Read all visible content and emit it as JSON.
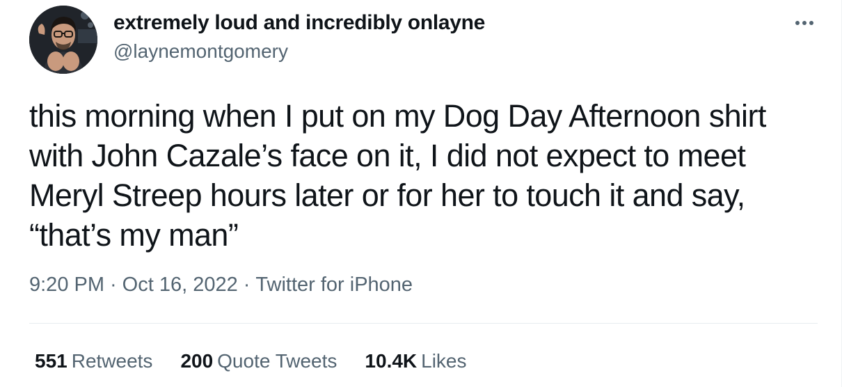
{
  "author": {
    "display_name": "extremely loud and incredibly onlayne",
    "handle": "@laynemontgomery",
    "avatar_icon": "profile-photo"
  },
  "more_icon": "ellipsis-icon",
  "tweet": {
    "lines": [
      "this morning when I put on my Dog Day Afternoon shirt",
      "with John Cazale’s face on it, I did not expect to meet",
      "Meryl Streep hours later or for her to touch it and say,",
      "“that’s my man”"
    ]
  },
  "meta": {
    "time": "9:20 PM",
    "separator": "·",
    "date": "Oct 16, 2022",
    "source": "Twitter for iPhone"
  },
  "stats": {
    "retweets": {
      "count": "551",
      "label": "Retweets"
    },
    "quotes": {
      "count": "200",
      "label": "Quote Tweets"
    },
    "likes": {
      "count": "10.4K",
      "label": "Likes"
    }
  },
  "colors": {
    "text_primary": "#0f1419",
    "text_secondary": "#536471",
    "divider": "#e6ecf0"
  }
}
